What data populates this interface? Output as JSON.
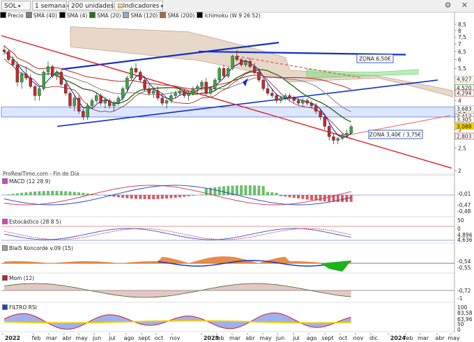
{
  "toolbar": {
    "symbol": "SOL",
    "timeframe": "1 semana",
    "units": "200 unidades",
    "indicators_label": "Indicadores"
  },
  "legend": [
    {
      "label": "Precio",
      "color": "#000000"
    },
    {
      "label": "SMA (40)",
      "color": "#7f7f7f"
    },
    {
      "label": "SMA (4)",
      "color": "#000000"
    },
    {
      "label": "SMA (20)",
      "color": "#2e6b1f"
    },
    {
      "label": "SMA (120)",
      "color": "#9aa8c0"
    },
    {
      "label": "SMA (200)",
      "color": "#a86b4a"
    },
    {
      "label": "Ichimoku (W 9 26 52)",
      "color": "#000000"
    }
  ],
  "source_label": "ProRealTime.com - Fin de Día",
  "panel_titles": {
    "macd": "MACD (12 28 9)",
    "stoch": "Estocástico (28 8 5)",
    "koncorde": "Blai5 Koncorde v.09 (15)",
    "mom": "Mom (12)",
    "rsi": "FILTRO RSI"
  },
  "colors": {
    "up": "#3aa83a",
    "down": "#c8282a",
    "trend_blue": "#1030c8",
    "trend_red": "#dd1f1f",
    "cloud_brown": "#c9a98a",
    "cloud_green": "#7fe07f",
    "zone_fill": "#dde6ff"
  },
  "chart_data": {
    "type": "candlestick",
    "title": "",
    "x_ticks": [
      "2022",
      "feb",
      "mar",
      "abr",
      "may",
      "jun",
      "jul",
      "ago",
      "sept",
      "oct",
      "nov",
      "2023",
      "feb",
      "mar",
      "abr",
      "may",
      "jun",
      "jul",
      "ago",
      "sept",
      "oct",
      "nov",
      "dic",
      "2024",
      "feb",
      "mar",
      "abr",
      "may"
    ],
    "x_ticks_bold": [
      "2022",
      "2023",
      "2024"
    ],
    "y_ticks": [
      "8,5",
      "8",
      "7,5",
      "7",
      "6,5",
      "6",
      "5,5",
      "5",
      "4,5",
      "4",
      "3,5",
      "3",
      "2,5",
      "2"
    ],
    "price_labels": [
      {
        "text": "4,927",
        "color": "#c9a98a"
      },
      {
        "text": "4,520",
        "color": "#2e6b1f"
      },
      {
        "text": "4,294",
        "color": "#dd1f1f"
      },
      {
        "text": "3,683",
        "color": "#c9a98a"
      },
      {
        "text": "3,413",
        "color": "#7f7f7f"
      },
      {
        "text": "3,305",
        "color": "#a86b4a"
      },
      {
        "text": "3,088",
        "color": "#f0d000"
      },
      {
        "text": "2,803",
        "color": "#dd1f1f"
      }
    ],
    "annotations": [
      "ZONA 6,50€",
      "ZONA 3,40€ / 3,75€"
    ],
    "zone_upper": [
      3.4,
      3.75
    ],
    "candles": [
      [
        6.6,
        6.9,
        6.3,
        6.5
      ],
      [
        6.5,
        6.6,
        5.9,
        6.0
      ],
      [
        6.0,
        6.2,
        5.6,
        5.7
      ],
      [
        5.7,
        5.9,
        4.6,
        4.8
      ],
      [
        4.8,
        5.3,
        4.5,
        5.2
      ],
      [
        5.2,
        5.6,
        4.9,
        5.0
      ],
      [
        5.0,
        5.2,
        4.5,
        4.6
      ],
      [
        4.6,
        4.7,
        4.0,
        4.2
      ],
      [
        4.2,
        4.6,
        4.0,
        4.5
      ],
      [
        4.5,
        5.4,
        4.4,
        5.3
      ],
      [
        5.3,
        5.9,
        5.1,
        5.6
      ],
      [
        5.6,
        5.7,
        5.0,
        5.1
      ],
      [
        5.1,
        5.4,
        4.9,
        5.3
      ],
      [
        5.3,
        5.4,
        4.6,
        4.7
      ],
      [
        4.7,
        4.8,
        4.2,
        4.3
      ],
      [
        4.3,
        4.4,
        3.7,
        3.8
      ],
      [
        3.8,
        4.2,
        3.6,
        4.1
      ],
      [
        4.1,
        4.2,
        3.5,
        3.6
      ],
      [
        3.6,
        3.7,
        3.3,
        3.4
      ],
      [
        3.4,
        3.9,
        3.3,
        3.8
      ],
      [
        3.8,
        4.1,
        3.7,
        4.0
      ],
      [
        4.0,
        4.3,
        3.9,
        4.2
      ],
      [
        4.2,
        4.3,
        3.8,
        3.9
      ],
      [
        3.9,
        4.1,
        3.7,
        4.0
      ],
      [
        4.0,
        4.1,
        3.7,
        3.8
      ],
      [
        3.8,
        4.0,
        3.6,
        3.9
      ],
      [
        3.9,
        4.2,
        3.8,
        4.1
      ],
      [
        4.1,
        4.6,
        4.0,
        4.5
      ],
      [
        4.5,
        5.1,
        4.4,
        5.0
      ],
      [
        5.0,
        5.6,
        4.9,
        5.5
      ],
      [
        5.5,
        5.8,
        5.2,
        5.3
      ],
      [
        5.3,
        5.4,
        4.8,
        4.9
      ],
      [
        4.9,
        5.0,
        4.4,
        4.5
      ],
      [
        4.5,
        4.7,
        4.2,
        4.3
      ],
      [
        4.3,
        4.5,
        4.1,
        4.4
      ],
      [
        4.4,
        4.6,
        4.0,
        4.1
      ],
      [
        4.1,
        4.3,
        3.8,
        3.9
      ],
      [
        3.9,
        4.1,
        3.7,
        4.0
      ],
      [
        4.0,
        4.3,
        3.9,
        4.2
      ],
      [
        4.2,
        4.4,
        4.1,
        4.3
      ],
      [
        4.3,
        4.5,
        4.2,
        4.4
      ],
      [
        4.4,
        4.5,
        4.1,
        4.2
      ],
      [
        4.2,
        4.4,
        4.0,
        4.3
      ],
      [
        4.3,
        4.6,
        4.2,
        4.5
      ],
      [
        4.5,
        4.7,
        4.3,
        4.6
      ],
      [
        4.6,
        4.9,
        4.4,
        4.8
      ],
      [
        4.8,
        5.0,
        4.2,
        4.3
      ],
      [
        4.3,
        4.6,
        4.2,
        4.5
      ],
      [
        4.5,
        5.0,
        4.4,
        4.9
      ],
      [
        4.9,
        5.6,
        4.8,
        5.5
      ],
      [
        5.5,
        5.7,
        5.0,
        5.1
      ],
      [
        5.1,
        5.6,
        5.0,
        5.5
      ],
      [
        5.5,
        6.3,
        5.4,
        6.2
      ],
      [
        6.2,
        6.6,
        5.9,
        6.0
      ],
      [
        6.0,
        6.1,
        5.6,
        5.7
      ],
      [
        5.7,
        6.0,
        5.6,
        5.9
      ],
      [
        5.9,
        6.1,
        5.5,
        5.6
      ],
      [
        5.6,
        5.8,
        5.2,
        5.3
      ],
      [
        5.3,
        5.5,
        4.8,
        4.9
      ],
      [
        4.9,
        5.0,
        4.4,
        4.5
      ],
      [
        4.5,
        4.7,
        4.2,
        4.3
      ],
      [
        4.3,
        4.5,
        4.1,
        4.2
      ],
      [
        4.2,
        4.3,
        3.9,
        4.0
      ],
      [
        4.0,
        4.2,
        3.9,
        4.1
      ],
      [
        4.1,
        4.3,
        4.0,
        4.2
      ],
      [
        4.2,
        4.3,
        4.0,
        4.1
      ],
      [
        4.1,
        4.2,
        3.9,
        4.0
      ],
      [
        4.0,
        4.1,
        3.8,
        3.9
      ],
      [
        3.9,
        4.1,
        3.8,
        4.0
      ],
      [
        4.0,
        4.1,
        3.8,
        3.9
      ],
      [
        3.9,
        4.0,
        3.7,
        3.8
      ],
      [
        3.8,
        3.9,
        3.5,
        3.6
      ],
      [
        3.6,
        3.7,
        3.3,
        3.4
      ],
      [
        3.4,
        3.5,
        3.0,
        3.1
      ],
      [
        3.1,
        3.2,
        2.7,
        2.8
      ],
      [
        2.8,
        2.9,
        2.6,
        2.7
      ],
      [
        2.7,
        2.8,
        2.6,
        2.75
      ],
      [
        2.75,
        2.9,
        2.7,
        2.85
      ],
      [
        2.85,
        3.0,
        2.8,
        2.9
      ],
      [
        2.9,
        3.15,
        2.85,
        3.09
      ]
    ]
  }
}
